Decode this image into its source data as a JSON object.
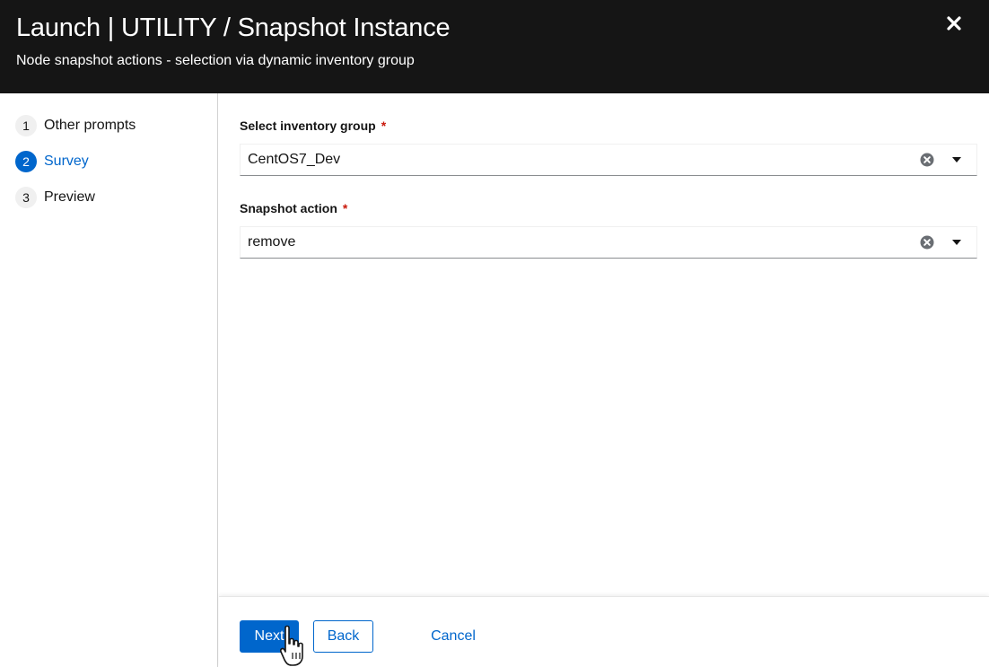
{
  "header": {
    "title": "Launch | UTILITY / Snapshot Instance",
    "subtitle": "Node snapshot actions - selection via dynamic inventory group",
    "close_icon": "close-icon"
  },
  "steps": [
    {
      "number": "1",
      "label": "Other prompts",
      "current": false
    },
    {
      "number": "2",
      "label": "Survey",
      "current": true
    },
    {
      "number": "3",
      "label": "Preview",
      "current": false
    }
  ],
  "form": {
    "inventory_group": {
      "label": "Select inventory group",
      "required_mark": "*",
      "value": "CentOS7_Dev"
    },
    "snapshot_action": {
      "label": "Snapshot action",
      "required_mark": "*",
      "value": "remove"
    }
  },
  "footer": {
    "next_label": "Next",
    "back_label": "Back",
    "cancel_label": "Cancel"
  },
  "colors": {
    "header_bg": "#151515",
    "accent": "#0066cc",
    "required": "#c9190b"
  }
}
